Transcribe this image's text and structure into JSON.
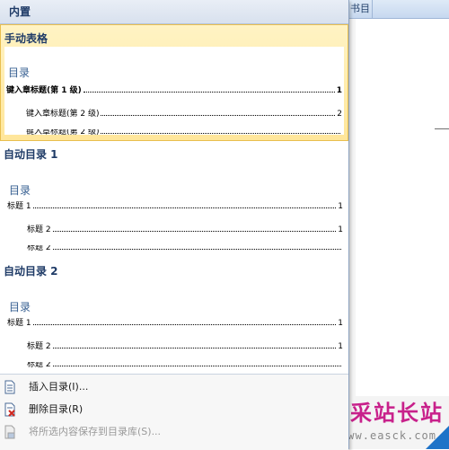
{
  "background": {
    "tab_label": "书目"
  },
  "gallery": {
    "header": "内置",
    "entries": [
      {
        "title": "手动表格",
        "heading": "目录",
        "lines": [
          {
            "text": "键入章标题(第 1 级)",
            "page": "1"
          },
          {
            "text": "键入章标题(第 2 级)",
            "page": "2"
          }
        ]
      },
      {
        "title": "自动目录 1",
        "heading": "目录",
        "lines": [
          {
            "text": "标题 1",
            "page": "1"
          },
          {
            "text": "标题 2",
            "page": "1"
          }
        ]
      },
      {
        "title": "自动目录 2",
        "heading": "目录",
        "lines": [
          {
            "text": "标题 1",
            "page": "1"
          },
          {
            "text": "标题 2",
            "page": "1"
          }
        ]
      }
    ]
  },
  "menu": {
    "insert_toc": "插入目录(I)...",
    "remove_toc": "删除目录(R)",
    "save_selection": "将所选内容保存到目录库(S)..."
  },
  "watermark": {
    "site_name": "易采站长站",
    "url": "www.easck.com"
  },
  "icons": {
    "insert": "document-icon",
    "remove": "document-delete-icon",
    "save": "save-to-gallery-icon"
  },
  "colors": {
    "selected_bg": "#ffe69a",
    "heading_blue": "#365f91",
    "title_blue": "#1f3b67",
    "watermark_magenta": "#c8218b"
  }
}
